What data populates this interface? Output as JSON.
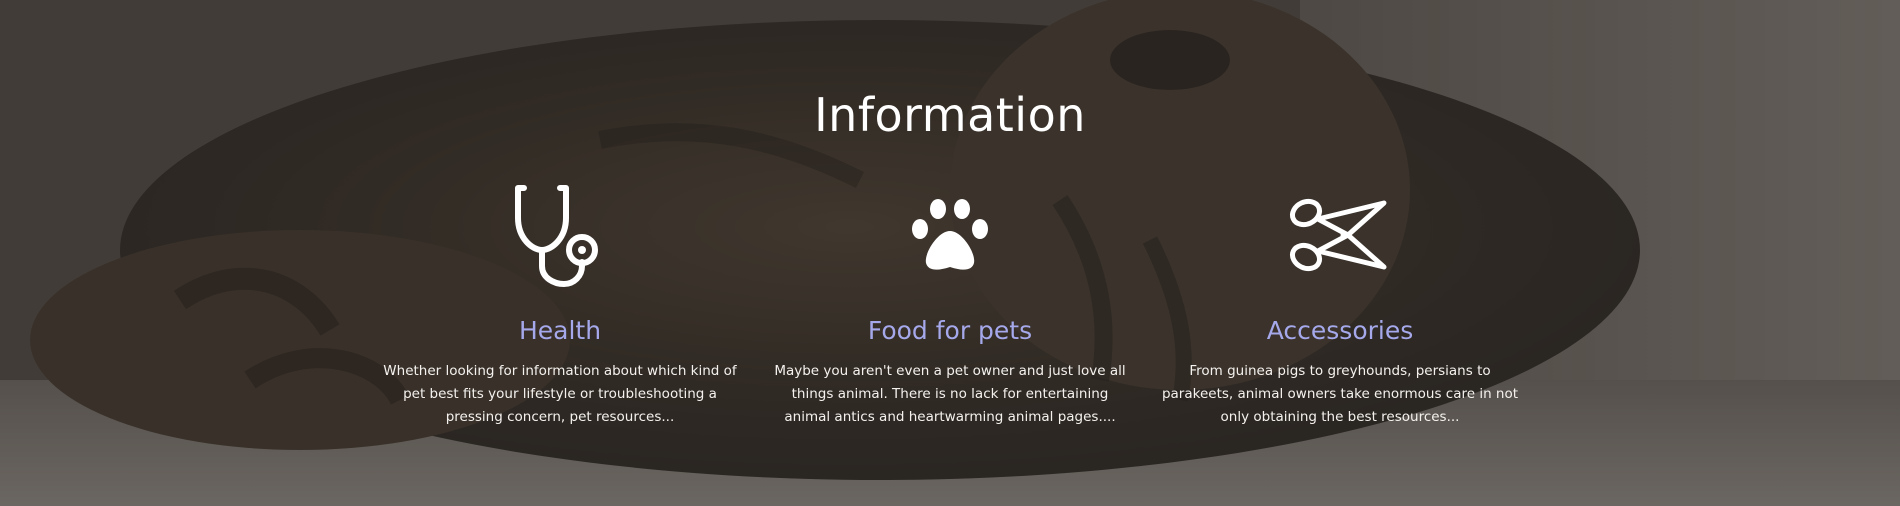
{
  "section": {
    "title": "Information"
  },
  "features": [
    {
      "icon": "stethoscope-icon",
      "heading": "Health",
      "text": "Whether looking for information about which kind of pet best fits your lifestyle or troubleshooting a pressing concern, pet resources..."
    },
    {
      "icon": "paw-icon",
      "heading": "Food for pets",
      "text": "Maybe you aren't even a pet owner and just love all things animal. There is no lack for entertaining animal antics and heartwarming animal pages...."
    },
    {
      "icon": "scissors-icon",
      "heading": "Accessories",
      "text": "From guinea pigs to greyhounds, persians to parakeets, animal owners take enormous care in not only obtaining the best resources..."
    }
  ],
  "colors": {
    "heading_accent": "#a5a8ea",
    "text": "#ffffff"
  }
}
